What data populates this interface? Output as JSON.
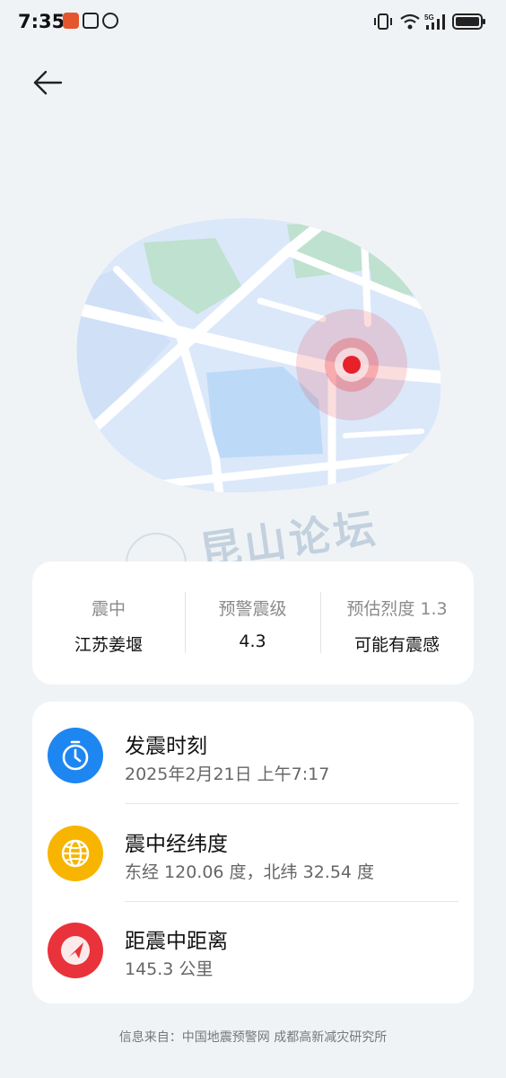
{
  "status_bar": {
    "time": "7:35",
    "left_icons": [
      "shield-app-icon",
      "nfc-icon",
      "alarm-icon"
    ],
    "right_icons": [
      "vibrate-icon",
      "wifi-icon",
      "signal-5g-icon",
      "battery-icon"
    ]
  },
  "header": {
    "back_icon": "arrow-left-icon"
  },
  "map": {
    "marker_color": "#e8202a",
    "water_color": "#bcd9f7",
    "park_color": "#bfe1cf"
  },
  "watermark": {
    "text": "昆山论坛"
  },
  "summary": {
    "epicenter_label": "震中",
    "epicenter_value": "江苏姜堰",
    "magnitude_label": "预警震级",
    "magnitude_value": "4.3",
    "intensity_label": "预估烈度 1.3",
    "intensity_value": "可能有震感"
  },
  "details": [
    {
      "icon": "clock-icon",
      "color": "#1e86f0",
      "title": "发震时刻",
      "value": "2025年2月21日 上午7:17"
    },
    {
      "icon": "globe-icon",
      "color": "#f7b500",
      "title": "震中经纬度",
      "value": "东经 120.06 度，北纬 32.54 度"
    },
    {
      "icon": "navigation-icon",
      "color": "#e9323a",
      "title": "距震中距离",
      "value": "145.3 公里"
    }
  ],
  "footer": {
    "text": "信息来自：中国地震预警网 成都高新减灾研究所"
  }
}
